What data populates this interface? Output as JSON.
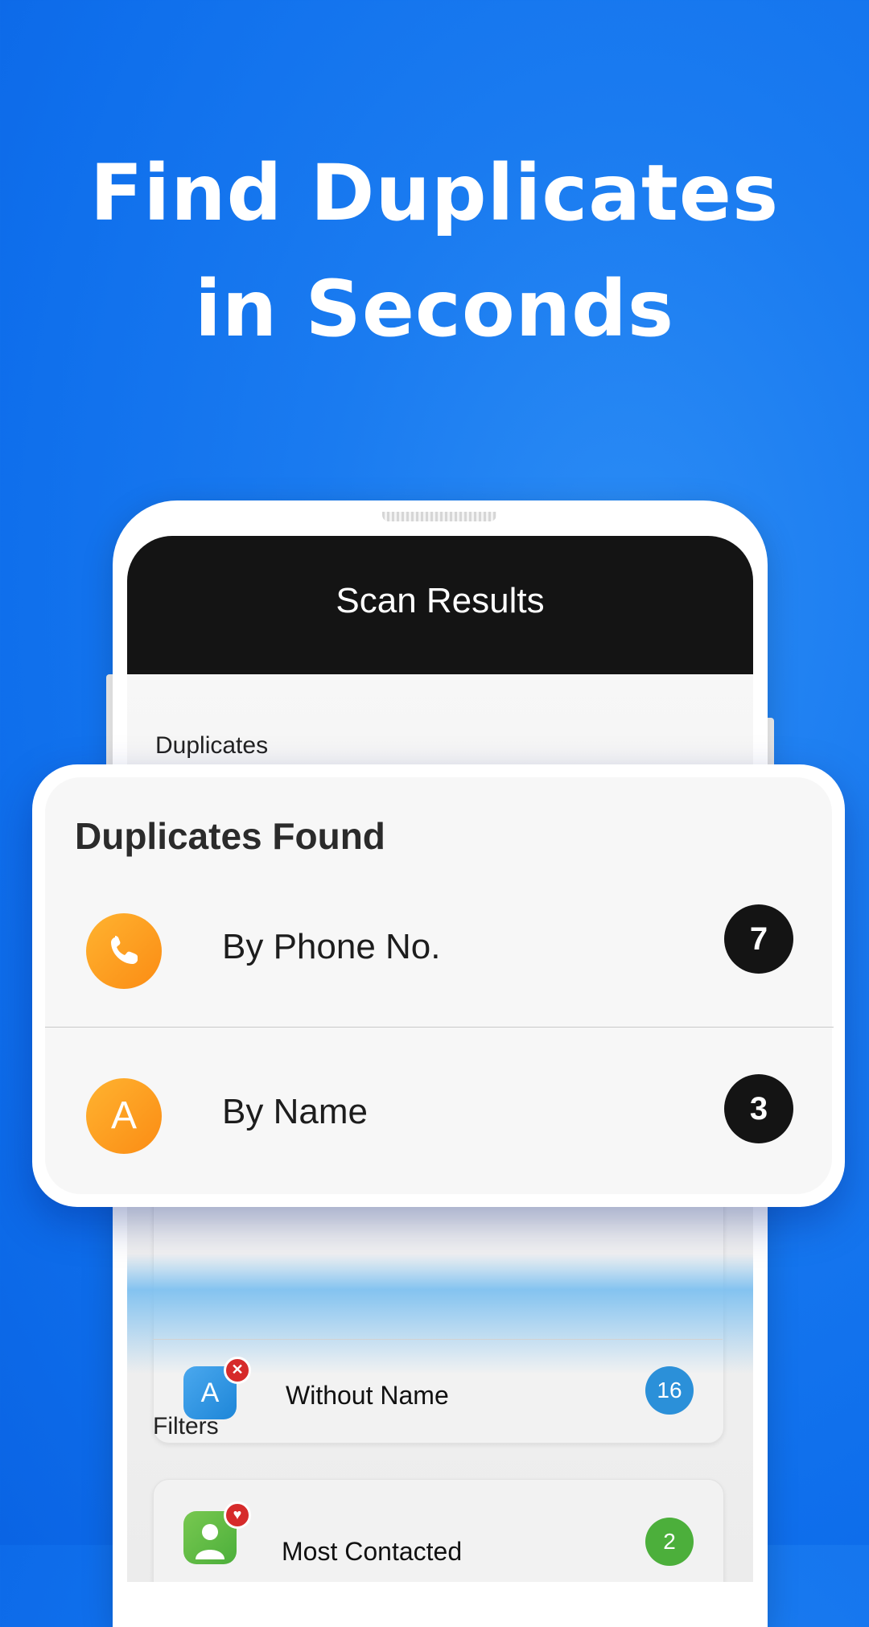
{
  "headline": {
    "line1": "Find Duplicates",
    "line2": "in Seconds"
  },
  "app": {
    "title": "Scan Results"
  },
  "screen": {
    "duplicates_section": "Duplicates",
    "without_name": {
      "label": "Without Name",
      "count": "16",
      "icon_letter": "A",
      "badge_icon": "close-icon"
    },
    "filters_section": "Filters",
    "most_contacted": {
      "label": "Most Contacted",
      "count": "2",
      "badge_icon": "heart-icon"
    }
  },
  "popup": {
    "title": "Duplicates Found",
    "rows": [
      {
        "label": "By Phone No.",
        "count": "7",
        "icon": "phone-icon"
      },
      {
        "label": "By Name",
        "count": "3",
        "icon": "letter-a-icon",
        "icon_letter": "A"
      }
    ]
  },
  "colors": {
    "background": "#1277ee",
    "accent_orange": "#fb8c14",
    "count_dark": "#141414",
    "count_blue": "#2b90d9",
    "count_green": "#4caf3b"
  }
}
